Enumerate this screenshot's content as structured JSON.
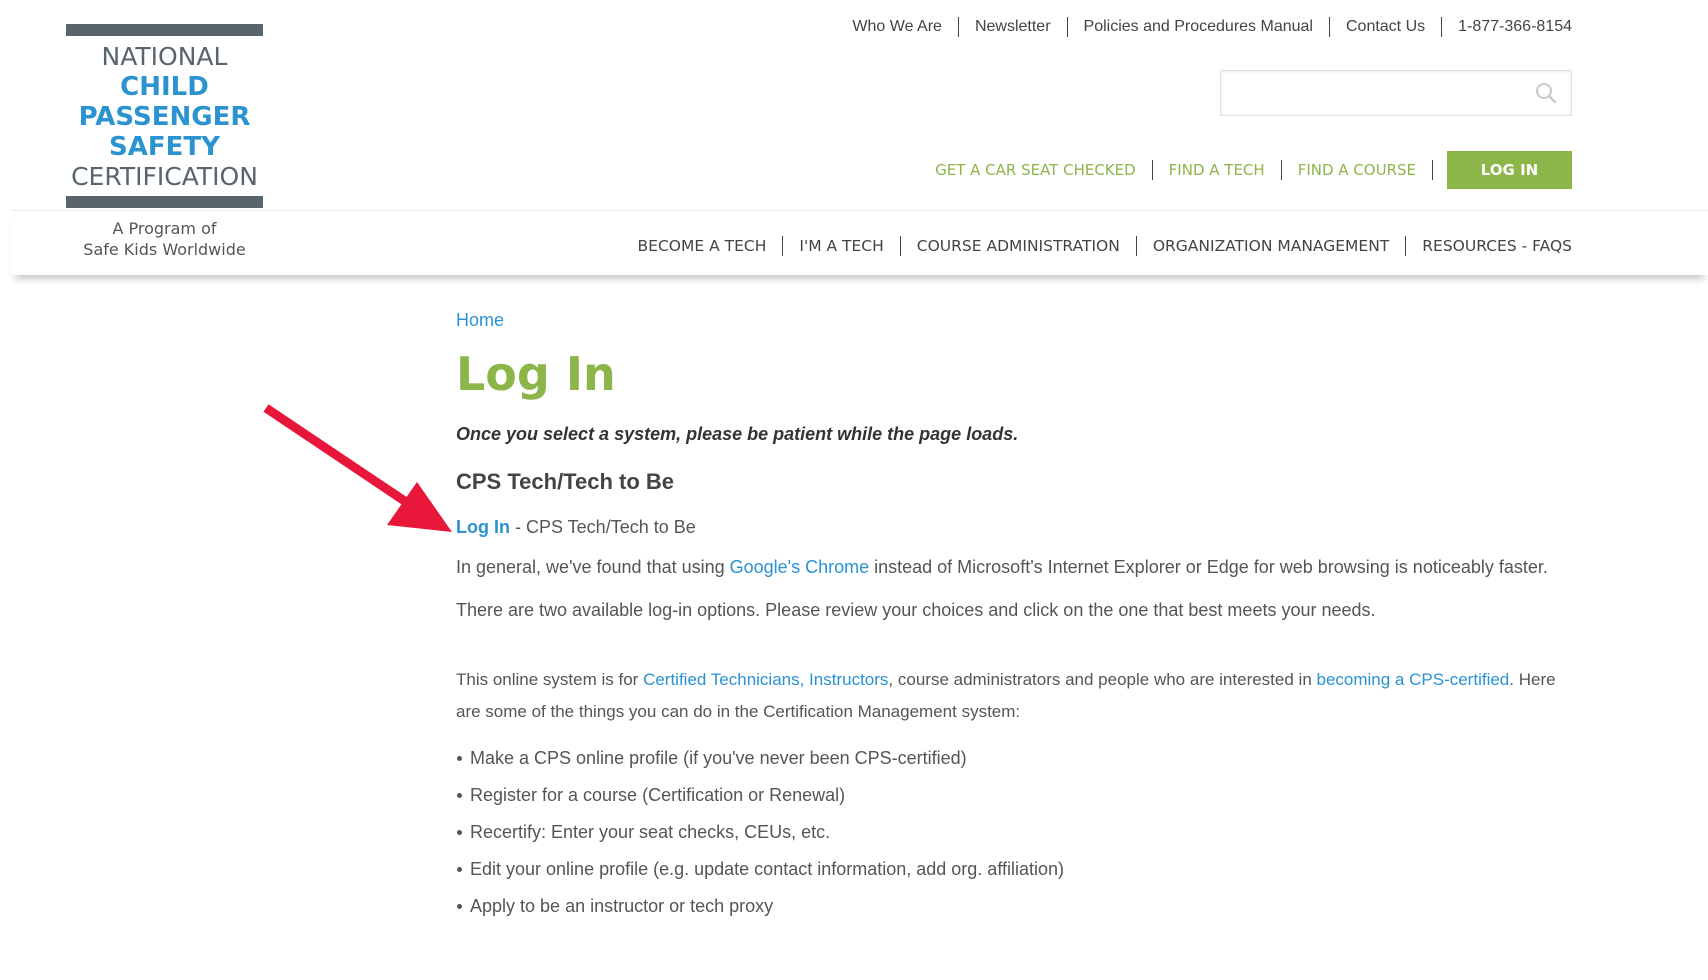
{
  "logo": {
    "line1": "NATIONAL",
    "line2": "CHILD",
    "line3": "PASSENGER",
    "line4": "SAFETY",
    "line5": "CERTIFICATION",
    "tagline1": "A Program of",
    "tagline2": "Safe Kids Worldwide"
  },
  "utility_nav": [
    "Who We Are",
    "Newsletter",
    "Policies and Procedures Manual",
    "Contact Us",
    "1-877-366-8154"
  ],
  "search": {
    "value": "",
    "placeholder": "",
    "icon": "search-icon"
  },
  "action_nav": {
    "items": [
      "GET A CAR SEAT CHECKED",
      "FIND A TECH",
      "FIND A COURSE"
    ],
    "login_button": "LOG IN"
  },
  "main_nav": [
    "BECOME A TECH",
    "I'M A TECH",
    "COURSE ADMINISTRATION",
    "ORGANIZATION MANAGEMENT",
    "RESOURCES - FAQS"
  ],
  "content": {
    "breadcrumb": "Home",
    "title": "Log In",
    "notice": "Once you select a system, please be patient while the page loads.",
    "section_title": "CPS Tech/Tech to Be",
    "login_link": "Log In",
    "login_suffix": " - CPS Tech/Tech to Be",
    "browser_text_before": "In general, we've found that using ",
    "browser_link": "Google's Chrome",
    "browser_text_after": " instead of Microsoft's Internet Explorer or Edge for web browsing is noticeably faster.",
    "options_text": "There are two available log-in options. Please review your choices and click on the one that best meets your needs.",
    "system_text_1": "This online system is for ",
    "system_link_1": "Certified Technicians, Instructors",
    "system_text_2": ", course administrators and people who are interested in ",
    "system_link_2": "becoming a CPS-certified",
    "system_text_3": ". Here are some of the things you can do in the Certification Management  system:",
    "features": [
      "Make a CPS online profile (if you've never been CPS-certified)",
      "Register for a course (Certification or Renewal)",
      "Recertify: Enter your seat checks, CEUs, etc.",
      "Edit your online profile (e.g. update contact information, add org. affiliation)",
      "Apply to be an instructor or tech proxy"
    ]
  },
  "colors": {
    "brand_green": "#8cb54a",
    "link_blue": "#2a93d0",
    "logo_gray": "#59656c",
    "annotation_arrow": "#e8173a"
  }
}
